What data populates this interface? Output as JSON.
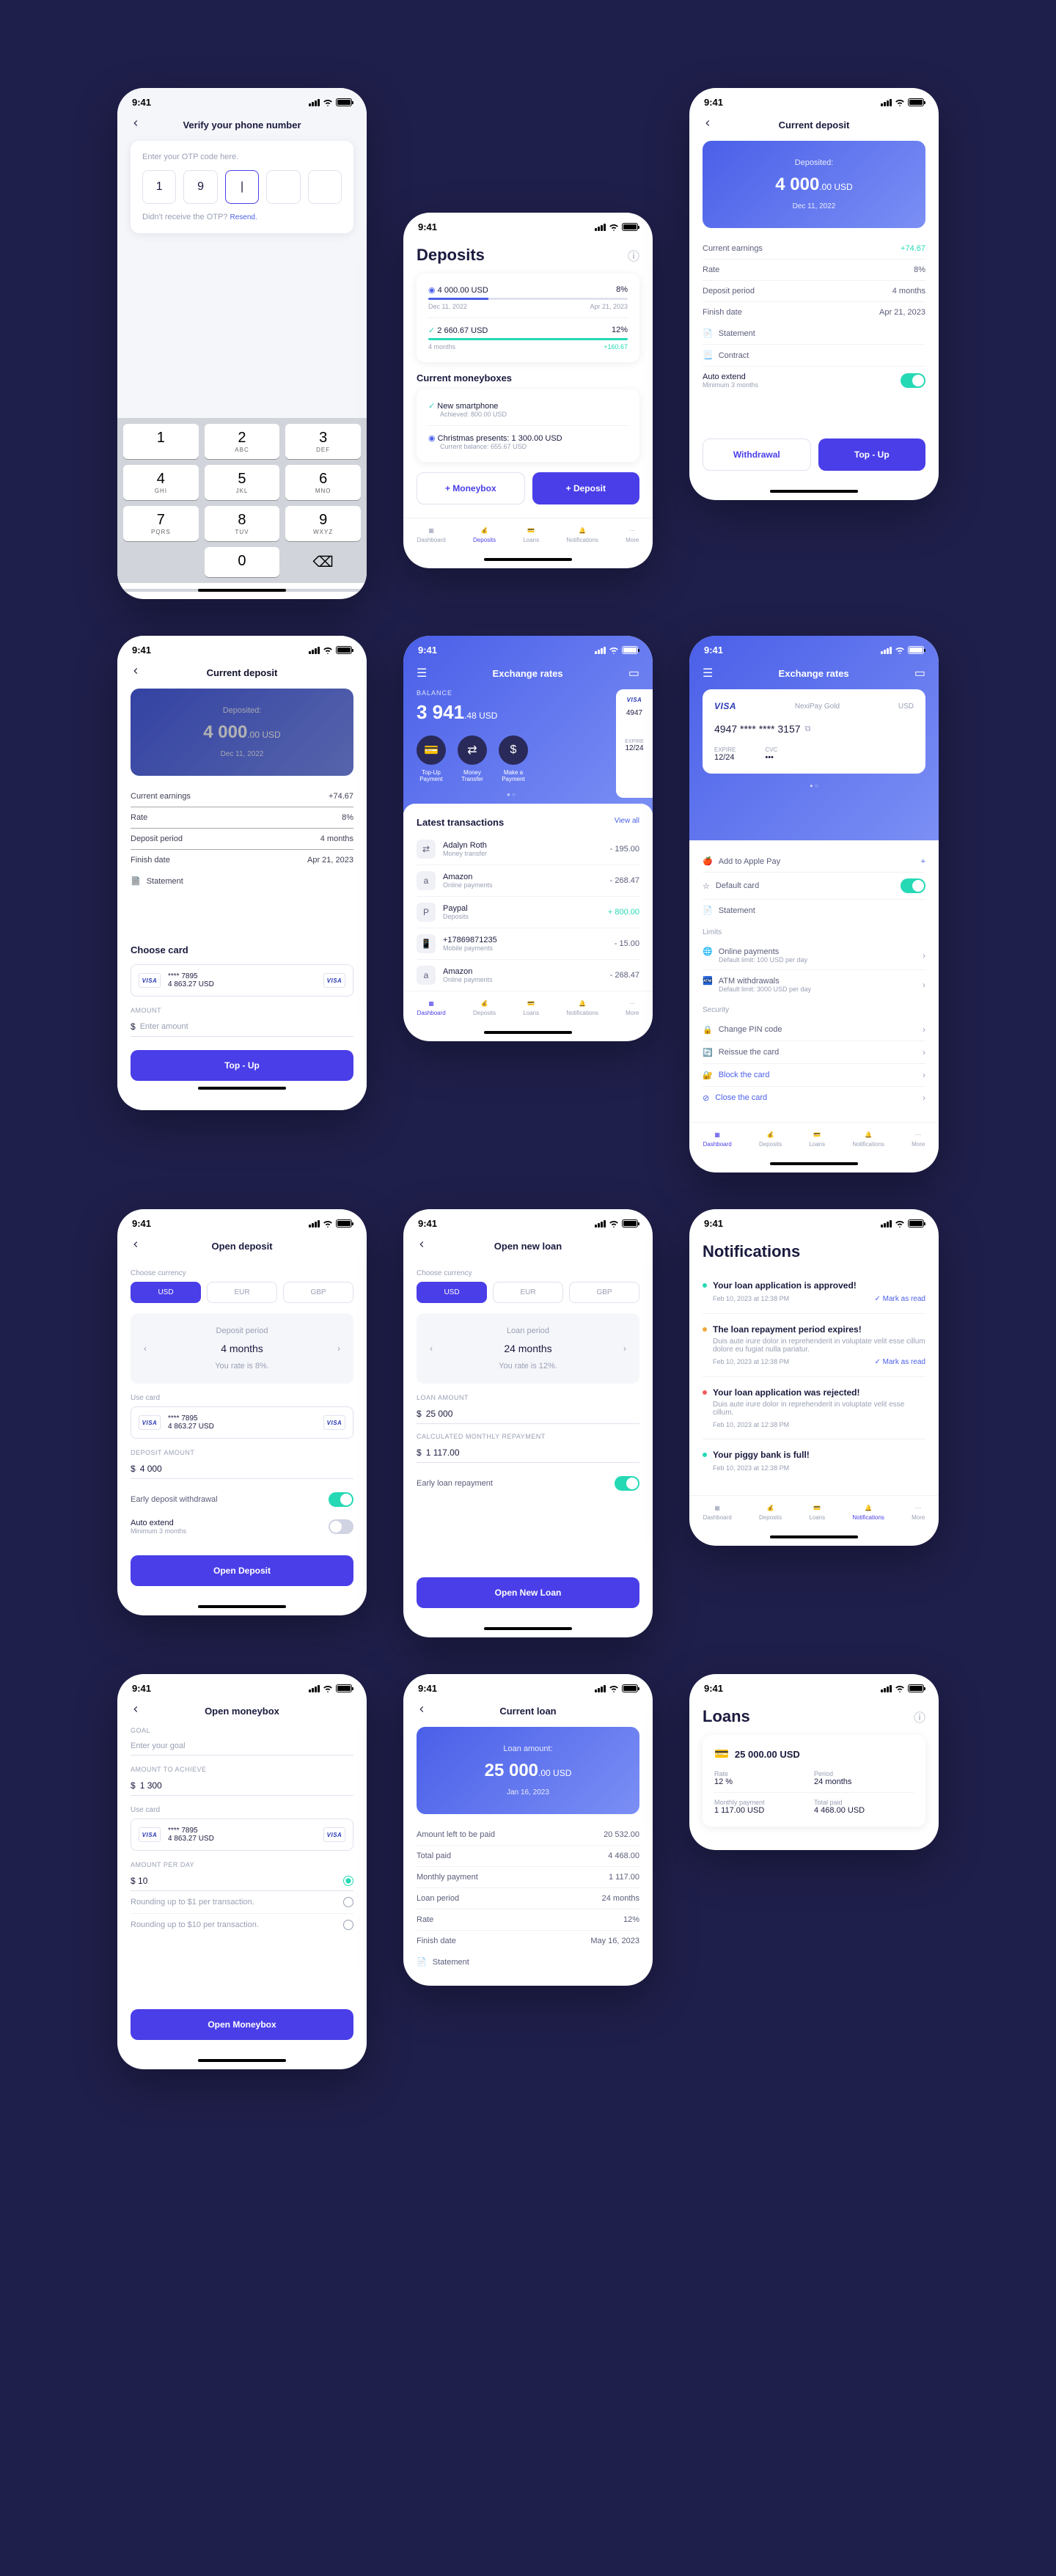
{
  "time": "9:41",
  "otp": {
    "title": "Verify your phone number",
    "prompt": "Enter your OTP code here.",
    "digits": [
      "1",
      "9",
      "|",
      "",
      ""
    ],
    "resend_prefix": "Didn't receive the OTP? ",
    "resend": "Resend.",
    "keys": [
      {
        "n": "1",
        "l": ""
      },
      {
        "n": "2",
        "l": "ABC"
      },
      {
        "n": "3",
        "l": "DEF"
      },
      {
        "n": "4",
        "l": "GHI"
      },
      {
        "n": "5",
        "l": "JKL"
      },
      {
        "n": "6",
        "l": "MNO"
      },
      {
        "n": "7",
        "l": "PQRS"
      },
      {
        "n": "8",
        "l": "TUV"
      },
      {
        "n": "9",
        "l": "WXYZ"
      },
      {
        "n": "",
        "l": ""
      },
      {
        "n": "0",
        "l": ""
      },
      {
        "n": "⌫",
        "l": ""
      }
    ]
  },
  "deposits": {
    "title": "Deposits",
    "list": [
      {
        "amount": "4 000.00 USD",
        "rate": "8%",
        "from": "Dec 11, 2022",
        "to": "Apr 21, 2023",
        "progress": 30,
        "color": "#4A5FE8"
      },
      {
        "amount": "2 660.67 USD",
        "rate": "12%",
        "from": "4 months",
        "to": "+160.67",
        "progress": 100,
        "color": "#25D9B5",
        "done": true
      }
    ],
    "mb_title": "Current moneyboxes",
    "mb": [
      {
        "name": "New smartphone",
        "sub": "Achieved: 800.00 USD",
        "done": true
      },
      {
        "name": "Christmas presents: 1 300.00 USD",
        "sub": "Current balance: 655.67 USD",
        "done": false
      }
    ],
    "btn1": "+ Moneybox",
    "btn2": "+ Deposit"
  },
  "curdep": {
    "title": "Current deposit",
    "label": "Deposited:",
    "amount_int": "4 000",
    "amount_dec": ".00 USD",
    "date": "Dec 11, 2022",
    "rows": [
      {
        "k": "Current earnings",
        "v": "+74.67",
        "green": true
      },
      {
        "k": "Rate",
        "v": "8%"
      },
      {
        "k": "Deposit period",
        "v": "4 months"
      },
      {
        "k": "Finish date",
        "v": "Apr 21, 2023"
      }
    ],
    "statement": "Statement",
    "contract": "Contract",
    "auto": "Auto extend",
    "auto_sub": "Minimum 3 months",
    "withdraw": "Withdrawal",
    "topup": "Top - Up"
  },
  "topup_modal": {
    "title": "Current deposit",
    "label": "Deposited:",
    "amount_int": "4 000",
    "amount_dec": ".00 USD",
    "date": "Dec 11, 2022",
    "rows": [
      {
        "k": "Current earnings",
        "v": "+74.67"
      },
      {
        "k": "Rate",
        "v": "8%"
      },
      {
        "k": "Deposit period",
        "v": "4 months"
      },
      {
        "k": "Finish date",
        "v": "Apr 21, 2023"
      }
    ],
    "statement": "Statement",
    "choose": "Choose card",
    "card_last": "**** 7895",
    "card_bal": "4 863.27 USD",
    "amount_label": "AMOUNT",
    "amount_ph": "Enter amount",
    "btn": "Top - Up"
  },
  "opendep": {
    "title": "Open deposit",
    "cur_label": "Choose currency",
    "curs": [
      "USD",
      "EUR",
      "GBP"
    ],
    "period_label": "Deposit period",
    "period": "4 months",
    "rate": "You rate is 8%.",
    "usecard": "Use card",
    "card_last": "**** 7895",
    "card_bal": "4 863.27 USD",
    "dep_amt_label": "DEPOSIT AMOUNT",
    "dep_amt": "4 000",
    "early": "Early deposit withdrawal",
    "auto": "Auto extend",
    "auto_sub": "Minimum 3 months",
    "btn": "Open Deposit"
  },
  "openmb": {
    "title": "Open moneybox",
    "goal_label": "GOAL",
    "goal_ph": "Enter your goal",
    "ach_label": "AMOUNT TO ACHIEVE",
    "ach": "1 300",
    "usecard": "Use card",
    "card_last": "**** 7895",
    "card_bal": "4 863.27 USD",
    "perday_label": "AMOUNT PER DAY",
    "perday": "10",
    "r1": "Rounding up to $1 per transaction.",
    "r2": "Rounding up to $10 per transaction.",
    "btn": "Open Moneybox"
  },
  "exch": {
    "title": "Exchange rates",
    "bal_label": "BALANCE",
    "bal_int": "3 941",
    "bal_dec": ".48 USD",
    "card_last": "4947",
    "exp_label": "EXPIRE",
    "exp": "12/24",
    "actions": [
      {
        "t1": "Top-Up",
        "t2": "Payment"
      },
      {
        "t1": "Money",
        "t2": "Transfer"
      },
      {
        "t1": "Make a",
        "t2": "Payment"
      }
    ],
    "lt": "Latest transactions",
    "viewall": "View all",
    "tx": [
      {
        "n": "Adalyn Roth",
        "s": "Money transfer",
        "v": "- 195.00"
      },
      {
        "n": "Amazon",
        "s": "Online payments",
        "v": "- 268.47"
      },
      {
        "n": "Paypal",
        "s": "Deposits",
        "v": "+ 800.00",
        "green": true
      },
      {
        "n": "+17869871235",
        "s": "Mobile payments",
        "v": "- 15.00"
      },
      {
        "n": "Amazon",
        "s": "Online payments",
        "v": "- 268.47"
      }
    ]
  },
  "openloan": {
    "title": "Open new loan",
    "cur_label": "Choose currency",
    "curs": [
      "USD",
      "EUR",
      "GBP"
    ],
    "period_label": "Loan period",
    "period": "24 months",
    "rate": "You rate is 12%.",
    "amt_label": "LOAN AMOUNT",
    "amt": "25 000",
    "rep_label": "CALCULATED MONTHLY REPAYMENT",
    "rep": "1 117.00",
    "early": "Early loan repayment",
    "btn": "Open New Loan"
  },
  "curloan": {
    "title": "Current loan",
    "label": "Loan amount:",
    "amount_int": "25 000",
    "amount_dec": ".00 USD",
    "date": "Jan 16, 2023",
    "rows": [
      {
        "k": "Amount left to be paid",
        "v": "20 532.00"
      },
      {
        "k": "Total paid",
        "v": "4 468.00"
      },
      {
        "k": "Monthly payment",
        "v": "1 117.00"
      },
      {
        "k": "Loan period",
        "v": "24 months"
      },
      {
        "k": "Rate",
        "v": "12%"
      },
      {
        "k": "Finish date",
        "v": "May 16, 2023"
      }
    ],
    "statement": "Statement"
  },
  "carddetail": {
    "title": "Exchange rates",
    "brand": "VISA",
    "name": "NexiPay Gold",
    "cur": "USD",
    "num": "4947 **** **** 3157",
    "exp_l": "EXPIRE",
    "exp": "12/24",
    "cvc_l": "CVC",
    "cvc": "•••",
    "apple": "Add to Apple Pay",
    "default": "Default card",
    "statement": "Statement",
    "limits": "Limits",
    "online": "Online payments",
    "online_sub": "Default limit: 100 USD per day",
    "atm": "ATM withdrawals",
    "atm_sub": "Default limit: 3000 USD per day",
    "security": "Security",
    "pin": "Change PIN code",
    "reissue": "Reissue the card",
    "block": "Block the card",
    "close": "Close the card"
  },
  "notif": {
    "title": "Notifications",
    "items": [
      {
        "dot": "#25D9B5",
        "t": "Your loan application is approved!",
        "date": "Feb 10, 2023 at 12:38 PM",
        "mark": true
      },
      {
        "dot": "#F2A93C",
        "t": "The loan repayment period expires!",
        "body": "Duis aute irure dolor in reprehenderit in voluptate velit esse cillum dolore eu fugiat nulla pariatur.",
        "date": "Feb 10, 2023 at 12:38 PM",
        "mark": true
      },
      {
        "dot": "#F25C5C",
        "t": "Your loan application was rejected!",
        "body": "Duis aute irure dolor in reprehenderit in voluptate velit esse cillum.",
        "date": "Feb 10, 2023 at 12:38 PM"
      },
      {
        "dot": "#25D9B5",
        "t": "Your piggy bank is full!",
        "date": "Feb 10, 2023 at 12:38 PM"
      }
    ],
    "mark": "Mark as read"
  },
  "loans": {
    "title": "Loans",
    "amount": "25 000.00 USD",
    "rows": [
      {
        "k1": "Rate",
        "v1": "12 %",
        "k2": "Period",
        "v2": "24 months"
      },
      {
        "k1": "Monthly payment",
        "v1": "1 117.00 USD",
        "k2": "Total paid",
        "v2": "4 468.00 USD"
      }
    ]
  },
  "tabs": [
    "Dashboard",
    "Deposits",
    "Loans",
    "Notifications",
    "More"
  ]
}
